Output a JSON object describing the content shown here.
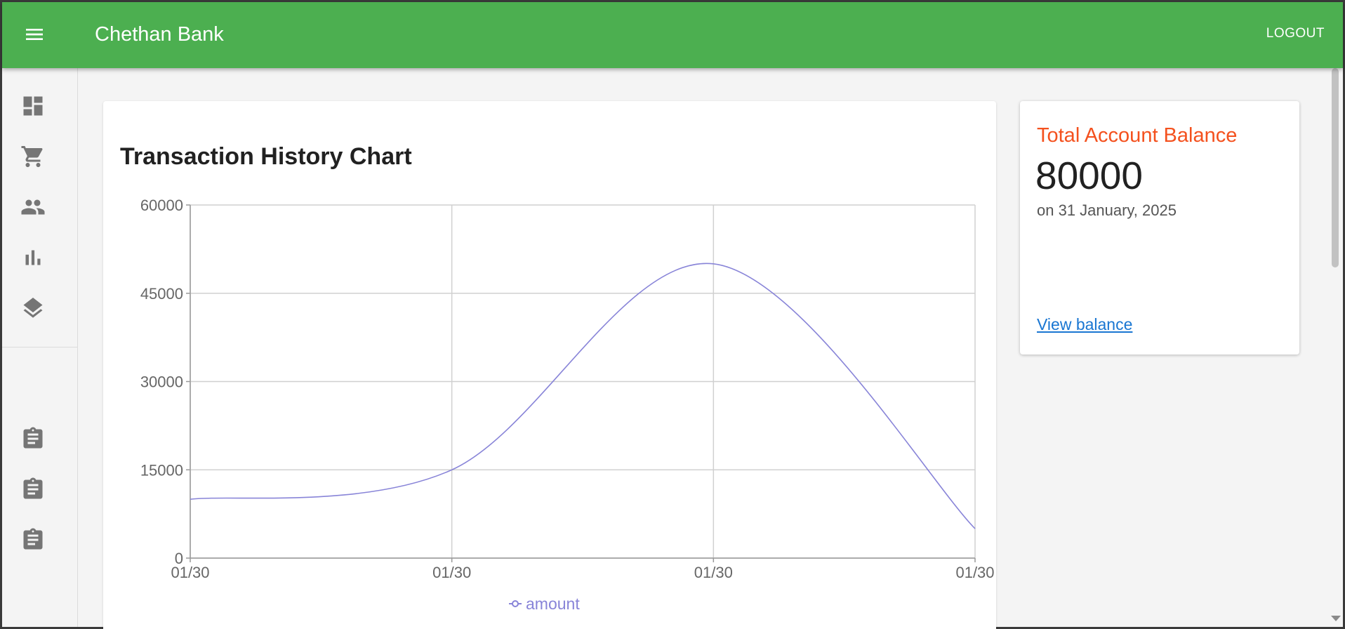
{
  "appbar": {
    "title": "Chethan Bank",
    "logout_label": "LOGOUT",
    "color": "#4caf50"
  },
  "sidebar": {
    "top_items": [
      {
        "icon": "dashboard-icon"
      },
      {
        "icon": "shopping-cart-icon"
      },
      {
        "icon": "people-icon"
      },
      {
        "icon": "bar-chart-icon"
      },
      {
        "icon": "layers-icon"
      }
    ],
    "bottom_items": [
      {
        "icon": "assignment-icon"
      },
      {
        "icon": "assignment-icon"
      },
      {
        "icon": "assignment-icon"
      }
    ]
  },
  "chart": {
    "title": "Transaction History Chart"
  },
  "chart_data": {
    "type": "line",
    "x": [
      "01/30",
      "01/30",
      "01/30",
      "01/30"
    ],
    "series": [
      {
        "name": "amount",
        "values": [
          10000,
          15000,
          50000,
          5000
        ],
        "color": "#8884d8"
      }
    ],
    "ylim": [
      0,
      60000
    ],
    "yticks": [
      0,
      15000,
      30000,
      45000,
      60000
    ],
    "grid": true,
    "legend": "bottom-center"
  },
  "balance": {
    "title": "Total Account Balance",
    "amount": "80000",
    "date": "on 31 January, 2025",
    "link_label": "View balance",
    "title_color": "#f4511e"
  }
}
